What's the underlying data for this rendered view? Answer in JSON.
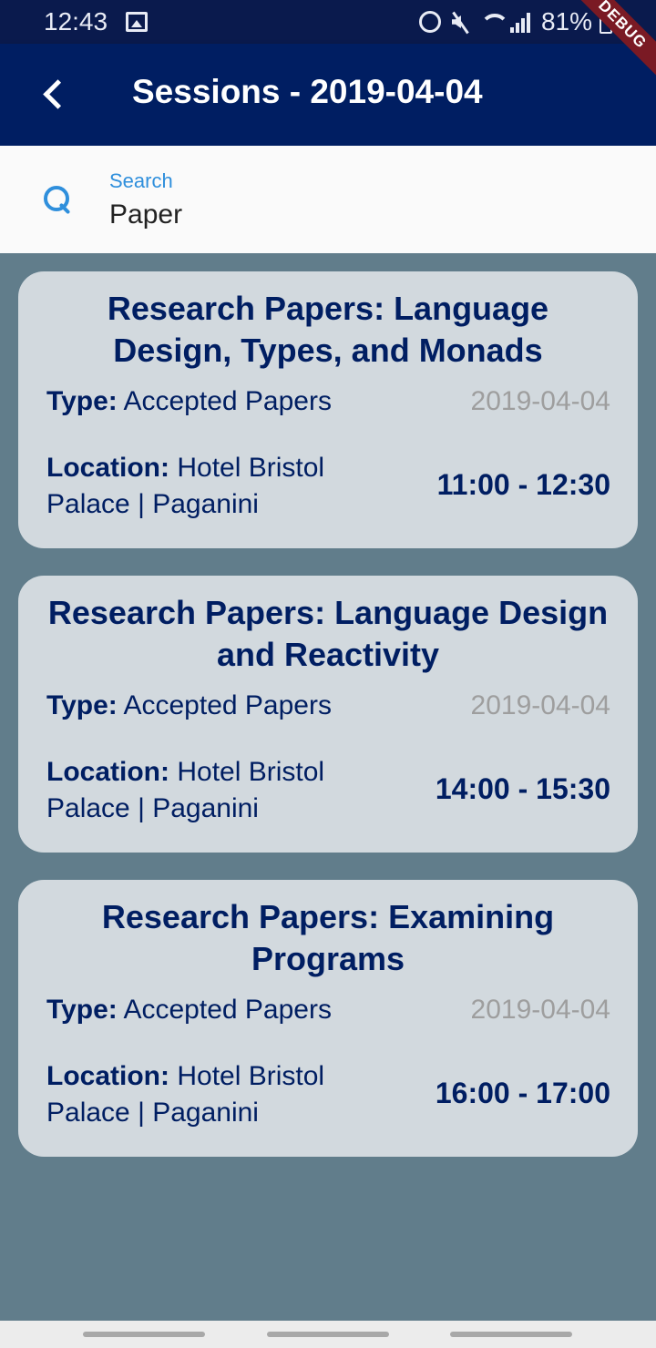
{
  "status_bar": {
    "time": "12:43",
    "battery": "81%",
    "icons": [
      "image-icon",
      "alarm-icon",
      "mute-icon",
      "wifi-icon",
      "signal-icon",
      "battery-icon"
    ]
  },
  "debug_banner": "DEBUG",
  "app_bar": {
    "title": "Sessions - 2019-04-04",
    "back_icon": "back-arrow-icon",
    "background_color": "#001e62"
  },
  "search": {
    "label": "Search",
    "value": "Paper",
    "icon": "search-icon",
    "accent_color": "#2f8fdc"
  },
  "sessions": [
    {
      "title": "Research Papers: Language Design, Types, and Monads",
      "type_label": "Type:",
      "type": "Accepted Papers",
      "date": "2019-04-04",
      "location_label": "Location:",
      "location": "Hotel Bristol Palace | Paganini",
      "time": "11:00 - 12:30"
    },
    {
      "title": "Research Papers: Language Design and Reactivity",
      "type_label": "Type:",
      "type": "Accepted Papers",
      "date": "2019-04-04",
      "location_label": "Location:",
      "location": "Hotel Bristol Palace | Paganini",
      "time": "14:00 - 15:30"
    },
    {
      "title": "Research Papers: Examining Programs",
      "type_label": "Type:",
      "type": "Accepted Papers",
      "date": "2019-04-04",
      "location_label": "Location:",
      "location": "Hotel Bristol Palace | Paganini",
      "time": "16:00 - 17:00"
    }
  ],
  "colors": {
    "list_background": "#617d8b",
    "card_background": "#d2d9de",
    "text_primary": "#001e62",
    "date_text": "#9e9e9e"
  }
}
